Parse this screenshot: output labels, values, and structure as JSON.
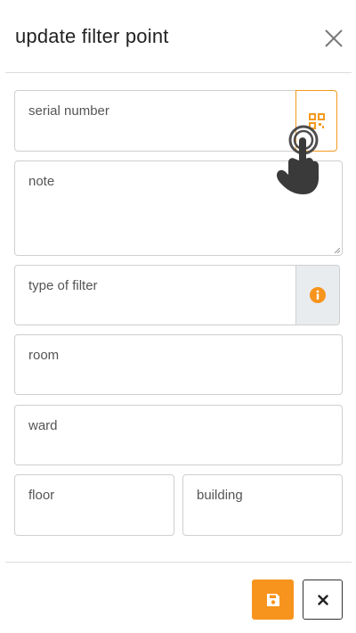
{
  "header": {
    "title": "update filter point"
  },
  "form": {
    "serial_number": {
      "placeholder": "serial number"
    },
    "note": {
      "placeholder": "note"
    },
    "type_of_filter": {
      "placeholder": "type of filter"
    },
    "room": {
      "placeholder": "room"
    },
    "ward": {
      "placeholder": "ward"
    },
    "floor": {
      "placeholder": "floor"
    },
    "building": {
      "placeholder": "building"
    }
  },
  "icons": {
    "close": "close-icon",
    "qr_scan": "qr-code-icon",
    "info": "info-icon",
    "save": "floppy-disk-icon",
    "cancel": "x-icon",
    "pointer": "hand-pointer-icon"
  },
  "colors": {
    "accent": "#f7941d",
    "border": "#cfcfcf",
    "addon_bg": "#e9ecef"
  }
}
